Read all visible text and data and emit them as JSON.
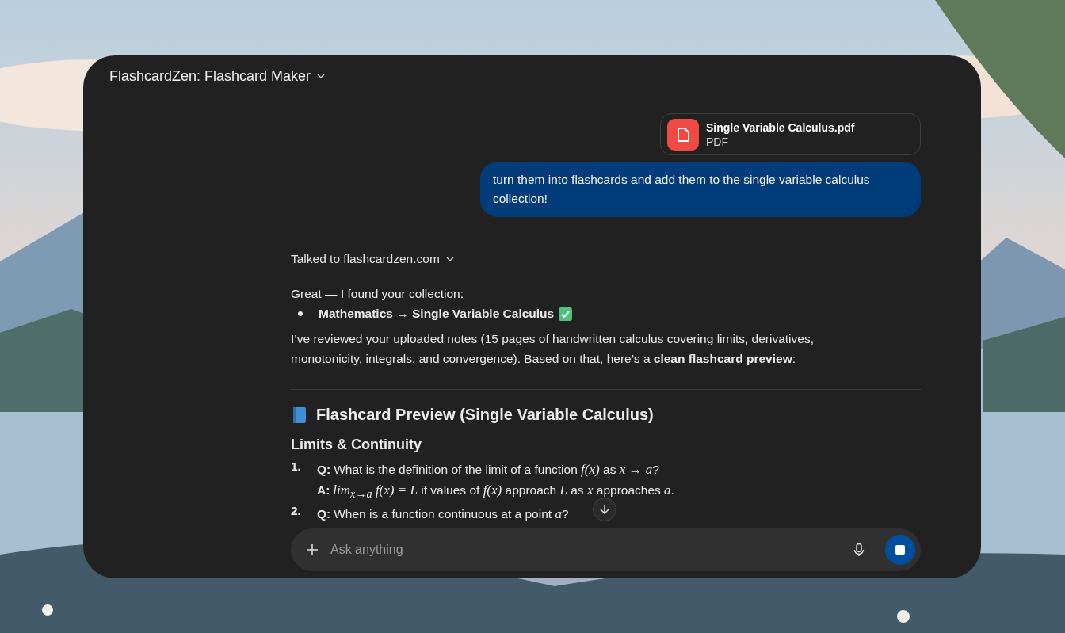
{
  "window": {
    "title": "FlashcardZen: Flashcard Maker"
  },
  "attachment": {
    "name": "Single Variable Calculus.pdf",
    "type": "PDF"
  },
  "user_message": "turn them into flashcards and add them to the single variable calculus collection!",
  "tool_call": "Talked to flashcardzen.com",
  "reply": {
    "intro": "Great — I found your collection:",
    "bullets": [
      "Mathematics → Single Variable Calculus"
    ],
    "paragraph": "I’ve reviewed your uploaded notes (15 pages of handwritten calculus covering limits, derivatives, monotonicity, integrals, and convergence). Based on that, here’s a **clean flashcard preview**:",
    "heading": "Flashcard Preview (Single Variable Calculus)",
    "section": "Limits & Continuity",
    "items": [
      {
        "number": "1.",
        "lines": [
          [
            {
              "kind": "label",
              "text": "Q:"
            },
            {
              "kind": "plain",
              "text": "What is the definition of the limit of a function "
            },
            {
              "kind": "math",
              "text": "f(x)"
            },
            {
              "kind": "plain",
              "text": " as "
            },
            {
              "kind": "math",
              "text": "x → a"
            },
            {
              "kind": "plain",
              "text": "?"
            }
          ],
          [
            {
              "kind": "label",
              "text": "A:"
            },
            {
              "kind": "math",
              "text": "lim$_{x→a}$ f(x) = L"
            },
            {
              "kind": "plain",
              "text": " if values of "
            },
            {
              "kind": "math",
              "text": "f(x)"
            },
            {
              "kind": "plain",
              "text": " approach "
            },
            {
              "kind": "math",
              "text": "L"
            },
            {
              "kind": "plain",
              "text": " as "
            },
            {
              "kind": "math",
              "text": "x"
            },
            {
              "kind": "plain",
              "text": " approaches "
            },
            {
              "kind": "math",
              "text": "a"
            },
            {
              "kind": "plain",
              "text": "."
            }
          ]
        ]
      },
      {
        "number": "2.",
        "lines": [
          [
            {
              "kind": "label",
              "text": "Q:"
            },
            {
              "kind": "plain",
              "text": "When is a function continuous at a point "
            },
            {
              "kind": "math",
              "text": "a"
            },
            {
              "kind": "plain",
              "text": "?"
            }
          ]
        ]
      }
    ]
  },
  "composer": {
    "placeholder": "Ask anything"
  }
}
